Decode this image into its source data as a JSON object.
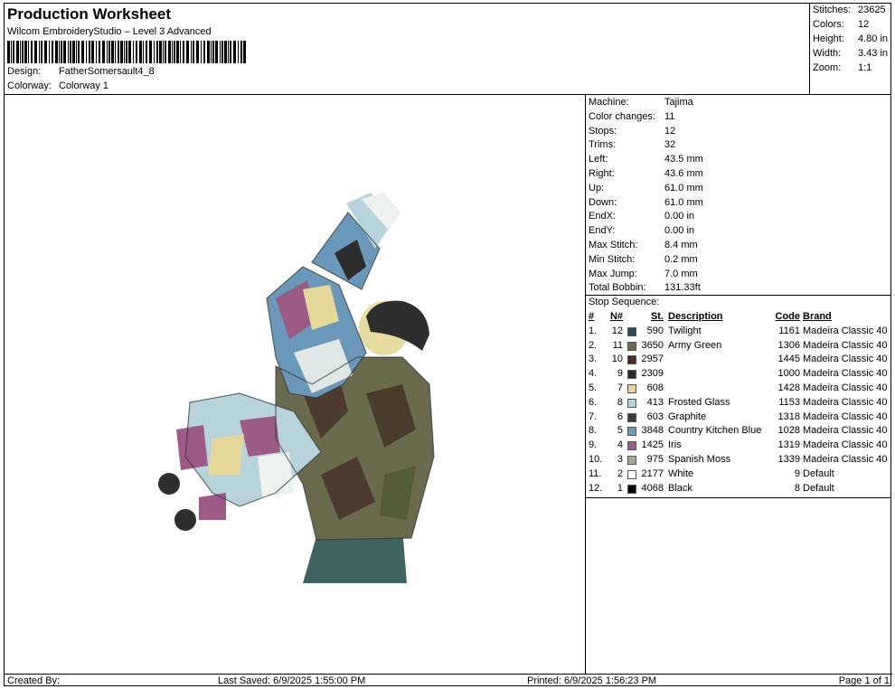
{
  "header": {
    "title": "Production Worksheet",
    "subtitle": "Wilcom EmbroideryStudio – Level 3 Advanced",
    "design_label": "Design:",
    "design_value": "FatherSomersault4_8",
    "colorway_label": "Colorway:",
    "colorway_value": "Colorway 1"
  },
  "stats": {
    "stitches_label": "Stitches:",
    "stitches_value": "23625",
    "colors_label": "Colors:",
    "colors_value": "12",
    "height_label": "Height:",
    "height_value": "4.80 in",
    "width_label": "Width:",
    "width_value": "3.43 in",
    "zoom_label": "Zoom:",
    "zoom_value": "1:1"
  },
  "machine_info": [
    {
      "label": "Machine:",
      "value": "Tajima"
    },
    {
      "label": "Color changes:",
      "value": "11"
    },
    {
      "label": "Stops:",
      "value": "12"
    },
    {
      "label": "Trims:",
      "value": "32"
    },
    {
      "label": "Left:",
      "value": "43.5 mm"
    },
    {
      "label": "Right:",
      "value": "43.6 mm"
    },
    {
      "label": "Up:",
      "value": "61.0 mm"
    },
    {
      "label": "Down:",
      "value": "61.0 mm"
    },
    {
      "label": "EndX:",
      "value": "0.00 in"
    },
    {
      "label": "EndY:",
      "value": "0.00 in"
    },
    {
      "label": "Max Stitch:",
      "value": "8.4 mm"
    },
    {
      "label": "Min Stitch:",
      "value": "0.2 mm"
    },
    {
      "label": "Max Jump:",
      "value": "7.0 mm"
    },
    {
      "label": "Total Bobbin:",
      "value": "131.33ft"
    }
  ],
  "stop_sequence": {
    "title": "Stop Sequence:",
    "headers": {
      "idx": "#",
      "n": "N#",
      "st": "St.",
      "desc": "Description",
      "code": "Code",
      "brand": "Brand"
    },
    "rows": [
      {
        "idx": "1.",
        "n": "12",
        "color": "#2c4a55",
        "st": "590",
        "desc": "Twilight",
        "code": "1161",
        "brand": "Madeira Classic 40"
      },
      {
        "idx": "2.",
        "n": "11",
        "color": "#6b6a4e",
        "st": "3650",
        "desc": "Army Green",
        "code": "1306",
        "brand": "Madeira Classic 40"
      },
      {
        "idx": "3.",
        "n": "10",
        "color": "#4a2c26",
        "st": "2957",
        "desc": "",
        "code": "1445",
        "brand": "Madeira Classic 40"
      },
      {
        "idx": "4.",
        "n": "9",
        "color": "#2b2b2b",
        "st": "2309",
        "desc": "",
        "code": "1000",
        "brand": "Madeira Classic 40"
      },
      {
        "idx": "5.",
        "n": "7",
        "color": "#e6d79b",
        "st": "608",
        "desc": "",
        "code": "1428",
        "brand": "Madeira Classic 40"
      },
      {
        "idx": "6.",
        "n": "8",
        "color": "#b7d3dc",
        "st": "413",
        "desc": "Frosted Glass",
        "code": "1153",
        "brand": "Madeira Classic 40"
      },
      {
        "idx": "7.",
        "n": "6",
        "color": "#3a3d3f",
        "st": "603",
        "desc": "Graphite",
        "code": "1318",
        "brand": "Madeira Classic 40"
      },
      {
        "idx": "8.",
        "n": "5",
        "color": "#6b97b8",
        "st": "3848",
        "desc": "Country Kitchen Blue",
        "code": "1028",
        "brand": "Madeira Classic 40"
      },
      {
        "idx": "9.",
        "n": "4",
        "color": "#9c5a86",
        "st": "1425",
        "desc": "Iris",
        "code": "1319",
        "brand": "Madeira Classic 40"
      },
      {
        "idx": "10.",
        "n": "3",
        "color": "#a7a89a",
        "st": "975",
        "desc": "Spanish Moss",
        "code": "1339",
        "brand": "Madeira Classic 40"
      },
      {
        "idx": "11.",
        "n": "2",
        "color": "#ffffff",
        "st": "2177",
        "desc": "White",
        "code": "9",
        "brand": "Default"
      },
      {
        "idx": "12.",
        "n": "1",
        "color": "#000000",
        "st": "4068",
        "desc": "Black",
        "code": "8",
        "brand": "Default"
      }
    ]
  },
  "footer": {
    "created_by": "Created By:",
    "last_saved": "Last Saved: 6/9/2025 1:55:00 PM",
    "printed": "Printed: 6/9/2025 1:56:23 PM",
    "page": "Page 1 of 1"
  }
}
